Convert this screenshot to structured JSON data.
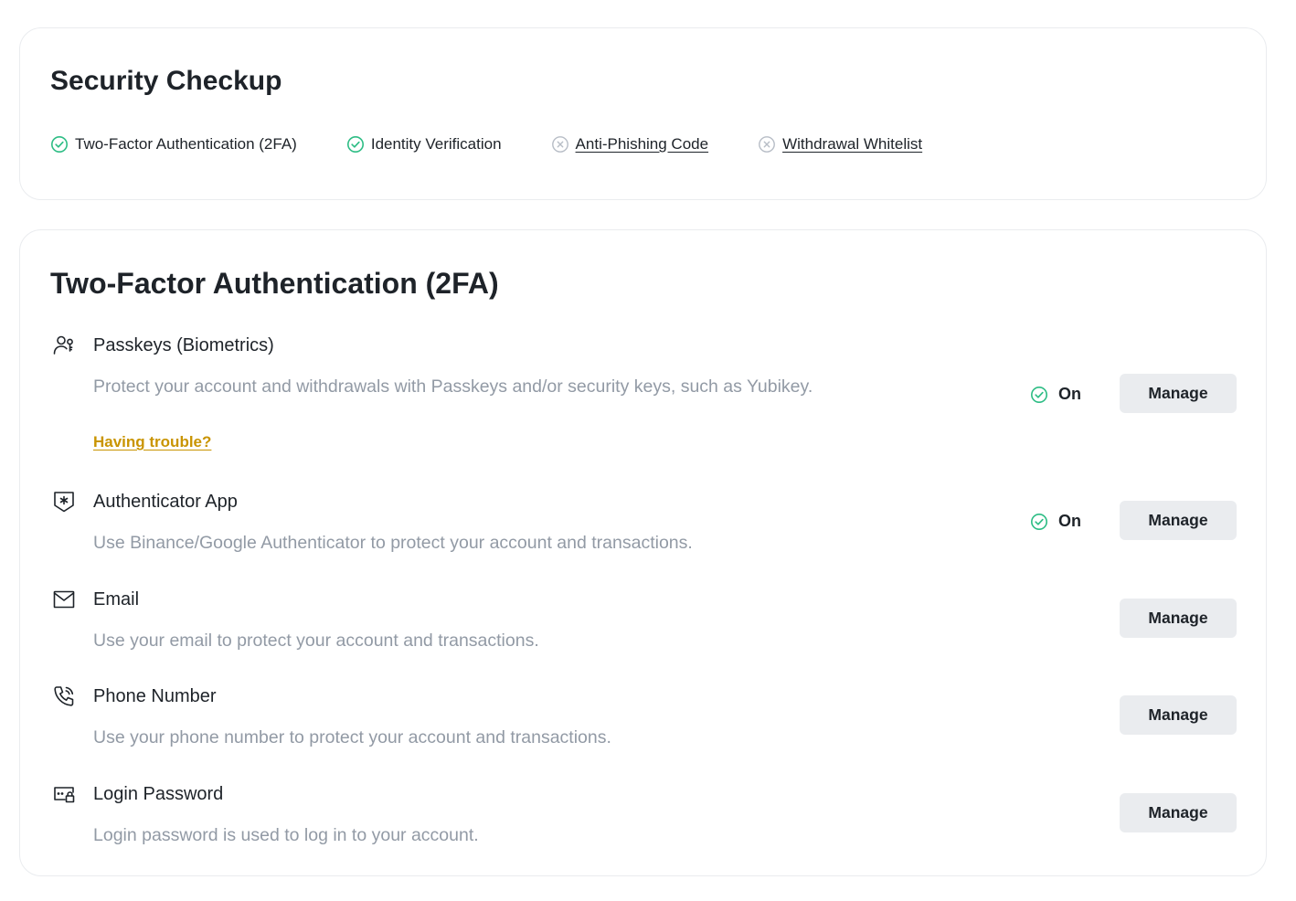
{
  "security_checkup": {
    "title": "Security Checkup",
    "items": [
      {
        "label": "Two-Factor Authentication (2FA)",
        "status": "complete",
        "icon": "check-circle-icon"
      },
      {
        "label": "Identity Verification",
        "status": "complete",
        "icon": "check-circle-icon"
      },
      {
        "label": "Anti-Phishing Code",
        "status": "incomplete",
        "icon": "x-circle-icon"
      },
      {
        "label": "Withdrawal Whitelist",
        "status": "incomplete",
        "icon": "x-circle-icon"
      }
    ]
  },
  "two_factor": {
    "title": "Two-Factor Authentication (2FA)",
    "methods": [
      {
        "icon": "passkey-users-icon",
        "title": "Passkeys (Biometrics)",
        "description": "Protect your account and withdrawals with Passkeys and/or security keys, such as Yubikey.",
        "link": "Having trouble?",
        "status": "On",
        "button": "Manage"
      },
      {
        "icon": "authenticator-shield-icon",
        "title": "Authenticator App",
        "description": "Use Binance/Google Authenticator to protect your account and transactions.",
        "status": "On",
        "button": "Manage"
      },
      {
        "icon": "envelope-icon",
        "title": "Email",
        "description": "Use your email to protect your account and transactions.",
        "button": "Manage"
      },
      {
        "icon": "phone-icon",
        "title": "Phone Number",
        "description": "Use your phone number to protect your account and transactions.",
        "button": "Manage"
      },
      {
        "icon": "password-lock-icon",
        "title": "Login Password",
        "description": "Login password is used to log in to your account.",
        "button": "Manage"
      }
    ]
  },
  "colors": {
    "success": "#2ebd85",
    "inactive": "#b7bdc6",
    "link_accent": "#c99400",
    "text_primary": "#1e2329",
    "text_secondary": "#929aa5",
    "button_bg": "#eaecef"
  }
}
